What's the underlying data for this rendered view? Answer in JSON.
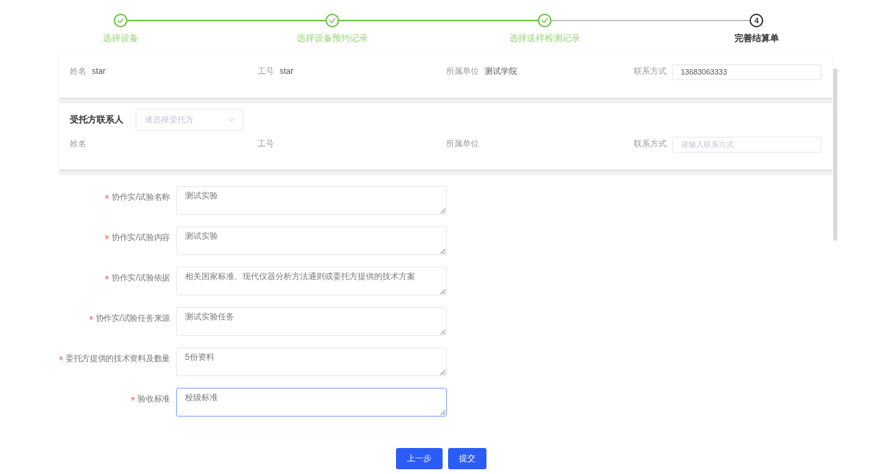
{
  "steps": [
    {
      "label": "选择设备",
      "completed": true
    },
    {
      "label": "选择设备预约记录",
      "completed": true
    },
    {
      "label": "选择送样检测记录",
      "completed": true
    },
    {
      "label": "完善结算单",
      "completed": false,
      "number": "4"
    }
  ],
  "applicant": {
    "fields": [
      {
        "kind": "text",
        "label": "姓名",
        "value": "star"
      },
      {
        "kind": "text",
        "label": "工号",
        "value": "star"
      },
      {
        "kind": "text",
        "label": "所属单位",
        "value": "测试学院"
      },
      {
        "kind": "input",
        "label": "联系方式",
        "value": "13683063333"
      }
    ]
  },
  "delegate": {
    "title": "受托方联系人",
    "select": {
      "placeholder": "请选择受托方"
    },
    "fields": [
      {
        "kind": "text",
        "label": "姓名"
      },
      {
        "kind": "text",
        "label": "工号"
      },
      {
        "kind": "text",
        "label": "所属单位"
      },
      {
        "kind": "input",
        "label": "联系方式",
        "placeholder": "请输入联系方式"
      }
    ]
  },
  "form": [
    {
      "label": "协作实/试验名称",
      "required": true,
      "value": "测试实验",
      "focused": false
    },
    {
      "label": "协作实/试验内容",
      "required": true,
      "value": "测试实验",
      "focused": false
    },
    {
      "label": "协作实/试验依据",
      "required": true,
      "value": "相关国家标准、现代仪器分析方法通则或委托方提供的技术方案",
      "focused": false
    },
    {
      "label": "协作实/试验任务来源",
      "required": true,
      "value": "测试实验任务",
      "focused": false
    },
    {
      "label": "委托方提供的技术资料及数量",
      "required": true,
      "value": "5份资料",
      "focused": false
    },
    {
      "label": "验收标准",
      "required": true,
      "value": "校级标准",
      "focused": true
    }
  ],
  "buttons": [
    {
      "label": "上一步"
    },
    {
      "label": "提交"
    }
  ]
}
